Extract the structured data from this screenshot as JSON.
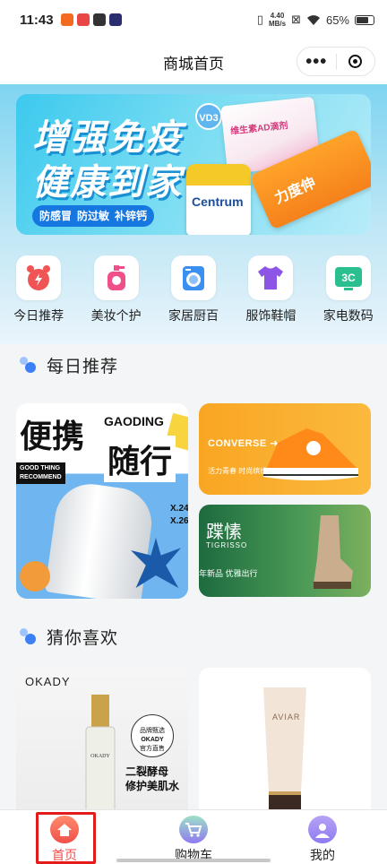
{
  "status_bar": {
    "time": "11:43",
    "speed_value": "4.40",
    "speed_unit": "MB/s",
    "battery": "65%"
  },
  "header": {
    "title": "商城首页",
    "more_icon": "ellipsis-icon",
    "close_icon": "target-circle-icon"
  },
  "banner": {
    "line1": "增强免疫",
    "line2": "健康到家",
    "tags": [
      "防感冒",
      "防过敏",
      "补锌钙"
    ],
    "badge": "VD3",
    "box_label": "维生素AD滴剂",
    "bottle_label": "Centrum",
    "tube_label": "力度伸"
  },
  "categories": [
    {
      "label": "今日推荐",
      "icon": "alarm-clock-icon",
      "color": "#f05454"
    },
    {
      "label": "美妆个护",
      "icon": "perfume-bottle-icon",
      "color": "#f0508a"
    },
    {
      "label": "家居厨百",
      "icon": "washing-machine-icon",
      "color": "#3b8ff0"
    },
    {
      "label": "服饰鞋帽",
      "icon": "t-shirt-icon",
      "color": "#8c55e6"
    },
    {
      "label": "家电数码",
      "icon": "3c-icon",
      "color": "#2bbf8f"
    }
  ],
  "sections": {
    "daily": "每日推荐",
    "guess": "猜你喜欢"
  },
  "promos": {
    "left": {
      "big1": "便携",
      "brand": "GAODING",
      "big2": "随行",
      "small_line1": "GOOD THING",
      "small_line2": "RECOMMEND",
      "x1": "X.24",
      "x2": "X.26"
    },
    "converse": {
      "brand": "CONVERSE",
      "sub": "活力青春 时尚缤纷"
    },
    "tigrisso": {
      "name": "蹀愫",
      "en": "TIGRISSO",
      "sub": "年新品 优雅出行"
    }
  },
  "products": {
    "left": {
      "brand": "OKADY",
      "badge_line1": "品牌甄选",
      "badge_brand": "OKADY",
      "badge_line2": "官方直售",
      "text1": "二裂酵母",
      "text2": "修护美肌水"
    },
    "right": {
      "brand": "AVIAR"
    }
  },
  "tabbar": {
    "tabs": [
      {
        "label": "首页",
        "icon": "home-icon",
        "active": true
      },
      {
        "label": "购物车",
        "icon": "cart-icon",
        "active": false
      },
      {
        "label": "我的",
        "icon": "user-icon",
        "active": false
      }
    ],
    "active_color": "#f04c4c"
  }
}
